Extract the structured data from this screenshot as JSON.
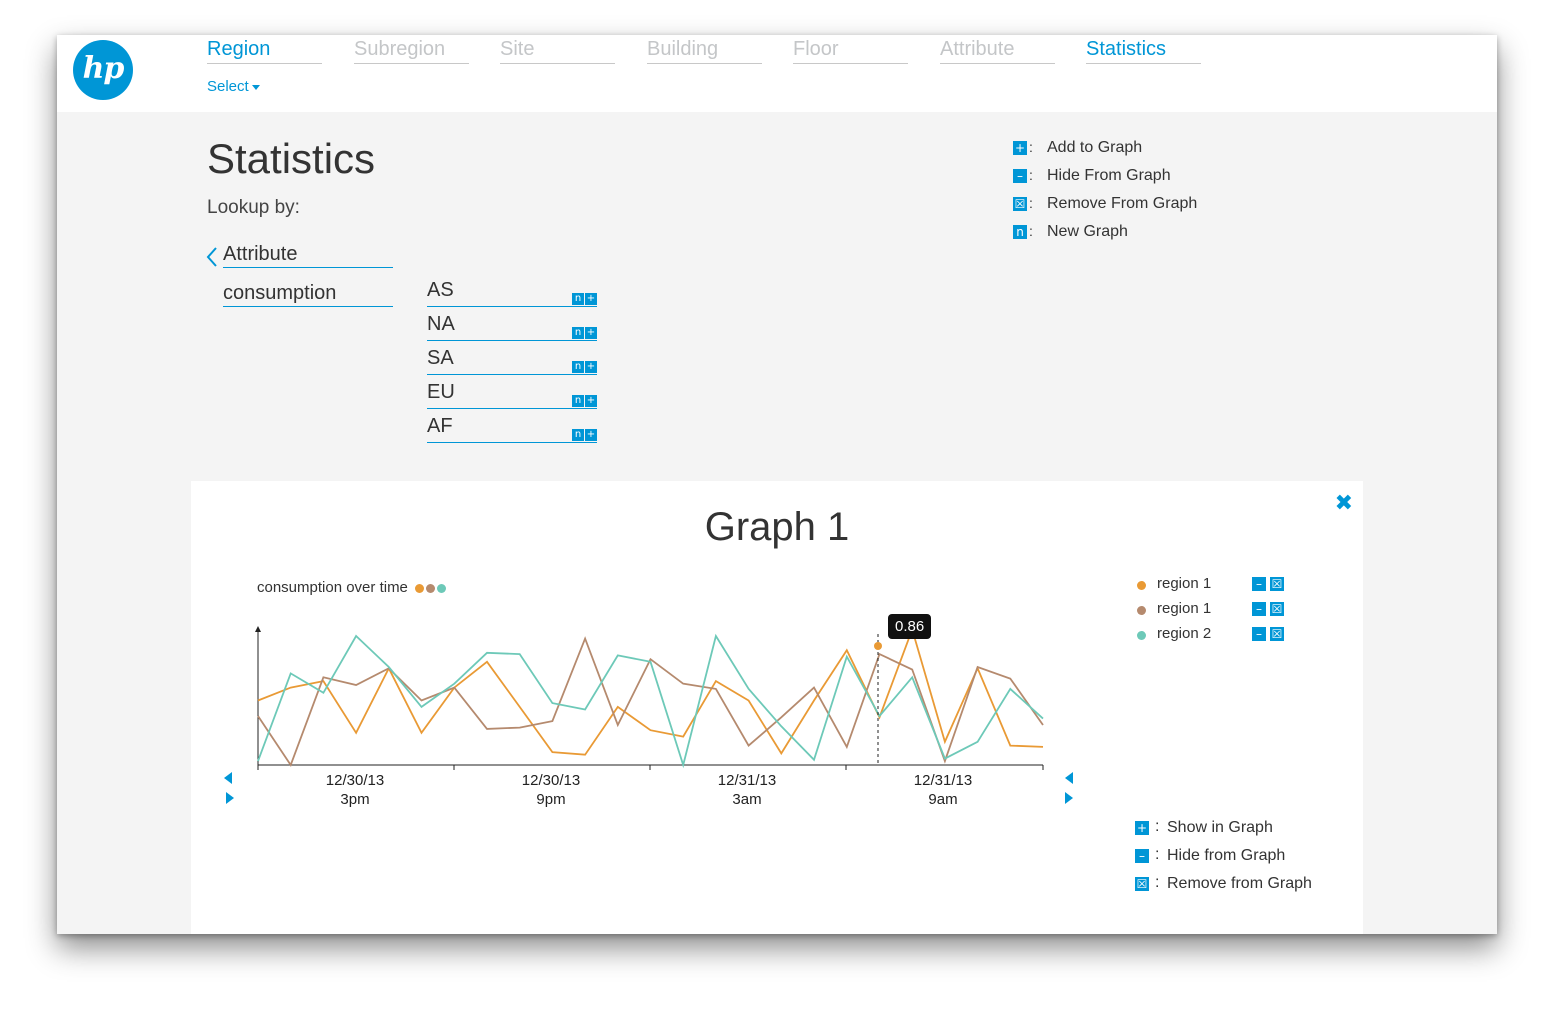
{
  "nav": {
    "breadcrumbs": [
      {
        "label": "Region",
        "active": true
      },
      {
        "label": "Subregion",
        "active": false
      },
      {
        "label": "Site",
        "active": false
      },
      {
        "label": "Building",
        "active": false
      },
      {
        "label": "Floor",
        "active": false
      },
      {
        "label": "Attribute",
        "active": false
      },
      {
        "label": "Statistics",
        "active": true
      }
    ],
    "select_label": "Select",
    "logo_text": "hp"
  },
  "page": {
    "title": "Statistics",
    "lookup_label": "Lookup by:",
    "attribute_label": "Attribute",
    "attribute_value": "consumption",
    "regions": [
      "AS",
      "NA",
      "SA",
      "EU",
      "AF"
    ],
    "new_icon": "n",
    "add_icon": "+"
  },
  "top_legend": [
    {
      "icon": "+",
      "name": "add",
      "text": "Add to Graph"
    },
    {
      "icon": "–",
      "name": "hide",
      "text": "Hide From Graph"
    },
    {
      "icon": "☒",
      "name": "remove",
      "text": "Remove From Graph"
    },
    {
      "icon": "n",
      "name": "new",
      "text": "New Graph"
    }
  ],
  "graph": {
    "title": "Graph 1",
    "close_icon": "✖",
    "subtitle": "consumption over time",
    "tooltip_value": "0.86",
    "series_legend": [
      {
        "name": "region 1",
        "color": "#e99a35"
      },
      {
        "name": "region 1",
        "color": "#b58a6e"
      },
      {
        "name": "region 2",
        "color": "#6dc9b8"
      }
    ],
    "bottom_legend": [
      {
        "icon": "+",
        "name": "show",
        "text": "Show in Graph"
      },
      {
        "icon": "–",
        "name": "hide",
        "text": "Hide from Graph"
      },
      {
        "icon": "☒",
        "name": "remove",
        "text": "Remove from Graph"
      }
    ]
  },
  "chart_data": {
    "type": "line",
    "title": "consumption over time",
    "x_ticks": [
      {
        "date": "12/30/13",
        "time": "3pm"
      },
      {
        "date": "12/30/13",
        "time": "9pm"
      },
      {
        "date": "12/31/13",
        "time": "3am"
      },
      {
        "date": "12/31/13",
        "time": "9am"
      }
    ],
    "x_count": 25,
    "ylim": [
      0,
      1
    ],
    "series": [
      {
        "name": "region 1",
        "color": "#e99a35",
        "values": [
          0.5,
          0.6,
          0.65,
          0.25,
          0.75,
          0.25,
          0.6,
          0.8,
          0.45,
          0.1,
          0.08,
          0.45,
          0.27,
          0.22,
          0.65,
          0.5,
          0.09,
          0.5,
          0.89,
          0.37,
          1.05,
          0.18,
          0.75,
          0.15,
          0.14
        ]
      },
      {
        "name": "region 1",
        "color": "#b58a6e",
        "values": [
          0.38,
          0.0,
          0.68,
          0.62,
          0.75,
          0.5,
          0.6,
          0.28,
          0.29,
          0.34,
          0.98,
          0.31,
          0.82,
          0.63,
          0.59,
          0.15,
          0.37,
          0.6,
          0.14,
          0.86,
          0.74,
          0.03,
          0.76,
          0.67,
          0.31
        ]
      },
      {
        "name": "region 2",
        "color": "#6dc9b8",
        "values": [
          0.03,
          0.71,
          0.56,
          1.0,
          0.76,
          0.45,
          0.63,
          0.87,
          0.86,
          0.48,
          0.43,
          0.85,
          0.8,
          0.0,
          1.0,
          0.59,
          0.3,
          0.04,
          0.84,
          0.38,
          0.68,
          0.05,
          0.18,
          0.59,
          0.36
        ]
      }
    ]
  }
}
